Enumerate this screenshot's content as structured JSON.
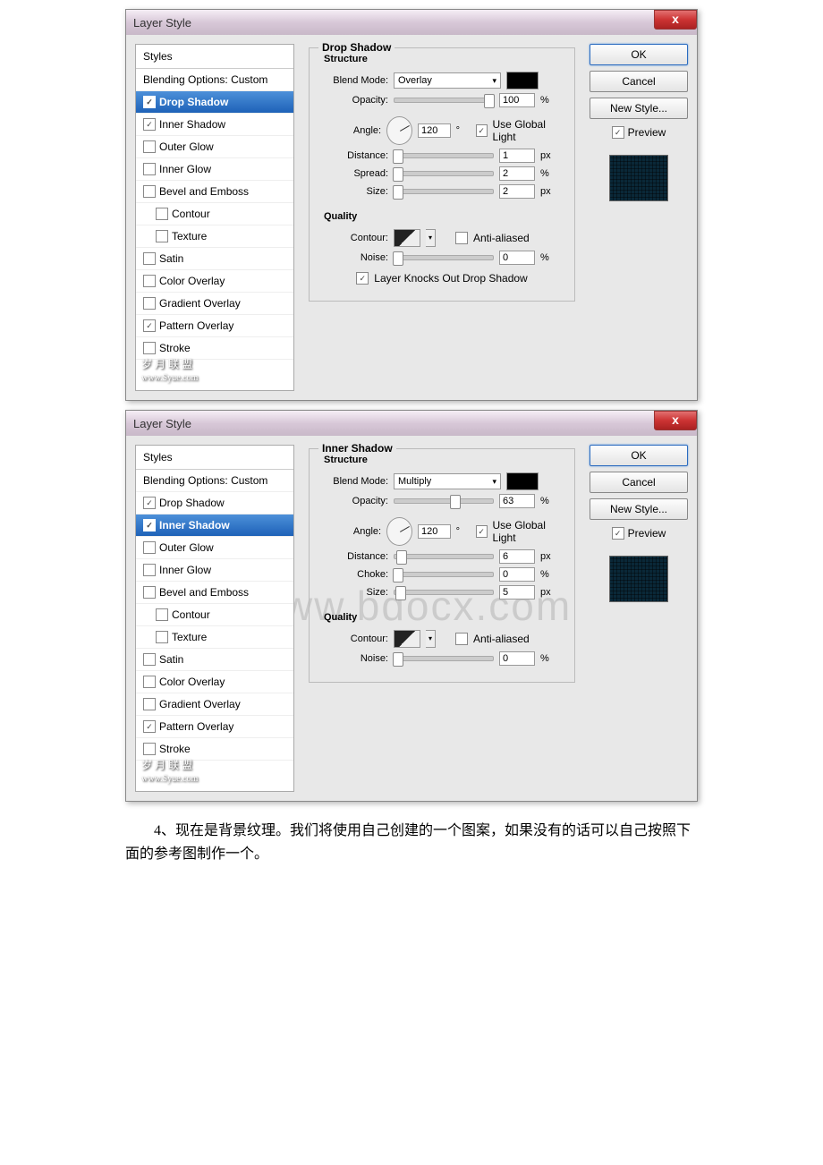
{
  "watermark_big": "www.bdocx.com",
  "dlg1": {
    "title": "Layer Style",
    "close": "x",
    "side": {
      "styles": "Styles",
      "blending": "Blending Options: Custom",
      "items": [
        "Drop Shadow",
        "Inner Shadow",
        "Outer Glow",
        "Inner Glow",
        "Bevel and Emboss",
        "Contour",
        "Texture",
        "Satin",
        "Color Overlay",
        "Gradient Overlay",
        "Pattern Overlay",
        "Stroke"
      ],
      "checked": [
        true,
        true,
        false,
        false,
        false,
        false,
        false,
        false,
        false,
        false,
        true,
        false
      ],
      "selected": 0,
      "sub": [
        5,
        6
      ]
    },
    "section_title": "Drop Shadow",
    "structure": "Structure",
    "blend_mode_lbl": "Blend Mode:",
    "blend_mode_val": "Overlay",
    "opacity_lbl": "Opacity:",
    "opacity_val": "100",
    "pct": "%",
    "angle_lbl": "Angle:",
    "angle_val": "120",
    "deg": "°",
    "ugl_lbl": "Use Global Light",
    "ugl": true,
    "distance_lbl": "Distance:",
    "distance_val": "1",
    "px": "px",
    "spread_lbl": "Spread:",
    "spread_val": "2",
    "size_lbl": "Size:",
    "size_val": "2",
    "quality": "Quality",
    "contour_lbl": "Contour:",
    "aa_lbl": "Anti-aliased",
    "aa": false,
    "noise_lbl": "Noise:",
    "noise_val": "0",
    "knock_lbl": "Layer Knocks Out Drop Shadow",
    "knock": true,
    "btns": {
      "ok": "OK",
      "cancel": "Cancel",
      "new": "New Style...",
      "preview": "Preview"
    },
    "wm1": "岁 月 联 盟",
    "wm2": "www.Syue.com"
  },
  "dlg2": {
    "title": "Layer Style",
    "close": "x",
    "side": {
      "styles": "Styles",
      "blending": "Blending Options: Custom",
      "items": [
        "Drop Shadow",
        "Inner Shadow",
        "Outer Glow",
        "Inner Glow",
        "Bevel and Emboss",
        "Contour",
        "Texture",
        "Satin",
        "Color Overlay",
        "Gradient Overlay",
        "Pattern Overlay",
        "Stroke"
      ],
      "checked": [
        true,
        true,
        false,
        false,
        false,
        false,
        false,
        false,
        false,
        false,
        true,
        false
      ],
      "selected": 1,
      "sub": [
        5,
        6
      ]
    },
    "section_title": "Inner Shadow",
    "structure": "Structure",
    "blend_mode_lbl": "Blend Mode:",
    "blend_mode_val": "Multiply",
    "opacity_lbl": "Opacity:",
    "opacity_val": "63",
    "pct": "%",
    "angle_lbl": "Angle:",
    "angle_val": "120",
    "deg": "°",
    "ugl_lbl": "Use Global Light",
    "ugl": true,
    "distance_lbl": "Distance:",
    "distance_val": "6",
    "px": "px",
    "choke_lbl": "Choke:",
    "choke_val": "0",
    "size_lbl": "Size:",
    "size_val": "5",
    "quality": "Quality",
    "contour_lbl": "Contour:",
    "aa_lbl": "Anti-aliased",
    "aa": false,
    "noise_lbl": "Noise:",
    "noise_val": "0",
    "btns": {
      "ok": "OK",
      "cancel": "Cancel",
      "new": "New Style...",
      "preview": "Preview"
    },
    "wm1": "岁 月 联 盟",
    "wm2": "www.Syue.com"
  },
  "article": "4、现在是背景纹理。我们将使用自己创建的一个图案，如果没有的话可以自己按照下面的参考图制作一个。"
}
